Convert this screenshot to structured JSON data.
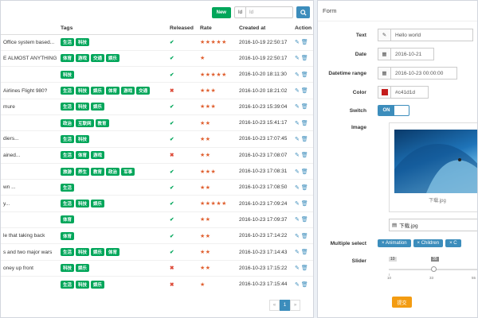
{
  "toolbar": {
    "new_label": "New",
    "field_select": "Id",
    "search_placeholder": "Id"
  },
  "table": {
    "headers": {
      "tags": "Tags",
      "released": "Released",
      "rate": "Rate",
      "created_at": "Created at",
      "action": "Action"
    },
    "rows": [
      {
        "title": "Office system based...",
        "tags": [
          "生活",
          "科技"
        ],
        "released": true,
        "stars": "★★★★★",
        "created": "2016-10-19 22:50:17"
      },
      {
        "title": "E ALMOST ANYTHING",
        "tags": [
          "体育",
          "游戏",
          "交通",
          "娱乐"
        ],
        "released": true,
        "stars": "★",
        "created": "2016-10-19 22:50:17"
      },
      {
        "title": "",
        "tags": [
          "科技"
        ],
        "released": true,
        "stars": "★★★★★",
        "created": "2016-10-20 18:11:30"
      },
      {
        "title": "Airlines Flight 980?",
        "tags": [
          "生活",
          "科技",
          "娱乐",
          "体育",
          "游戏",
          "交通"
        ],
        "released": false,
        "stars": "★★★",
        "created": "2016-10-20 18:21:02"
      },
      {
        "title": "mure",
        "tags": [
          "生活",
          "科技",
          "娱乐"
        ],
        "released": true,
        "stars": "★★★",
        "created": "2016-10-23 15:39:04"
      },
      {
        "title": "",
        "tags": [
          "政治",
          "互联网",
          "教育"
        ],
        "released": true,
        "stars": "★★",
        "created": "2016-10-23 15:41:17"
      },
      {
        "title": "diers...",
        "tags": [
          "生活",
          "科技"
        ],
        "released": true,
        "stars": "★★",
        "created": "2016-10-23 17:07:45"
      },
      {
        "title": "ained...",
        "tags": [
          "生活",
          "体育",
          "游戏"
        ],
        "released": false,
        "stars": "★★",
        "created": "2016-10-23 17:08:07"
      },
      {
        "title": "",
        "tags": [
          "旅游",
          "养生",
          "教育",
          "政治",
          "军事"
        ],
        "released": true,
        "stars": "★★★",
        "created": "2016-10-23 17:08:31"
      },
      {
        "title": "wn ...",
        "tags": [
          "生活"
        ],
        "released": true,
        "stars": "★★",
        "created": "2016-10-23 17:08:50"
      },
      {
        "title": "y...",
        "tags": [
          "生活",
          "科技",
          "娱乐"
        ],
        "released": true,
        "stars": "★★★★★",
        "created": "2016-10-23 17:09:24"
      },
      {
        "title": "",
        "tags": [
          "体育"
        ],
        "released": true,
        "stars": "★★",
        "created": "2016-10-23 17:09:37"
      },
      {
        "title": "le that taking back",
        "tags": [
          "体育"
        ],
        "released": true,
        "stars": "★★",
        "created": "2016-10-23 17:14:22"
      },
      {
        "title": "s and two major wars",
        "tags": [
          "生活",
          "科技",
          "娱乐",
          "体育"
        ],
        "released": true,
        "stars": "★★",
        "created": "2016-10-23 17:14:43"
      },
      {
        "title": "oney up front",
        "tags": [
          "科技",
          "娱乐"
        ],
        "released": false,
        "stars": "★★",
        "created": "2016-10-23 17:15:22"
      },
      {
        "title": "",
        "tags": [
          "生活",
          "科技",
          "娱乐"
        ],
        "released": false,
        "stars": "★",
        "created": "2016-10-23 17:15:44"
      }
    ]
  },
  "pagination": {
    "prev": "«",
    "current": "1",
    "next": "»"
  },
  "form": {
    "title": "Form",
    "text_label": "Text",
    "text_value": "Hello world",
    "date_label": "Date",
    "date_value": "2016-10-21",
    "datetime_label": "Datetime range",
    "datetime_value": "2016-10-23 00:00:00",
    "color_label": "Color",
    "color_value": "#c41d1d",
    "color_hex": "#c41d1d",
    "switch_label": "Switch",
    "switch_on": "ON",
    "image_label": "Image",
    "image_caption": "下载.jpg",
    "file_name": "下载.jpg",
    "multiselect_label": "Multiple select",
    "multiselect_chips": [
      "Animation",
      "Children",
      "C"
    ],
    "slider_label": "Slider",
    "slider_min": "10",
    "slider_handle_a": "10",
    "slider_handle_b": "35",
    "slider_ticks": [
      "10",
      "33",
      "55"
    ],
    "submit_label": "提交"
  },
  "colors": {
    "brand": "#3c8dbc",
    "success": "#00a65a",
    "danger": "#dd4b39",
    "warning": "#f39c12",
    "star": "#e06030"
  }
}
